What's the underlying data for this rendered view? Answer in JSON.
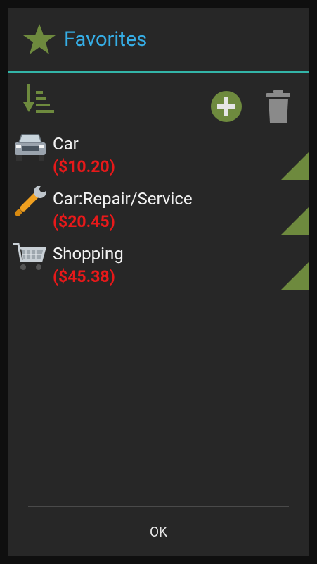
{
  "dialog": {
    "title": "Favorites",
    "title_icon": "star-icon",
    "accent_color": "#33b5a8"
  },
  "toolbar": {
    "sort_icon": "sort-icon",
    "add_icon": "add-icon",
    "delete_icon": "trash-icon"
  },
  "favorites": [
    {
      "name": "Car",
      "amount": "($10.20)",
      "icon": "car-icon"
    },
    {
      "name": "Car:Repair/Service",
      "amount": "($20.45)",
      "icon": "wrench-icon"
    },
    {
      "name": "Shopping",
      "amount": "($45.38)",
      "icon": "shopping-cart-icon"
    }
  ],
  "footer": {
    "ok_label": "OK"
  },
  "colors": {
    "background": "#272727",
    "title_text": "#36aee6",
    "amount_negative": "#e8191a",
    "green": "#6e8a3e"
  }
}
